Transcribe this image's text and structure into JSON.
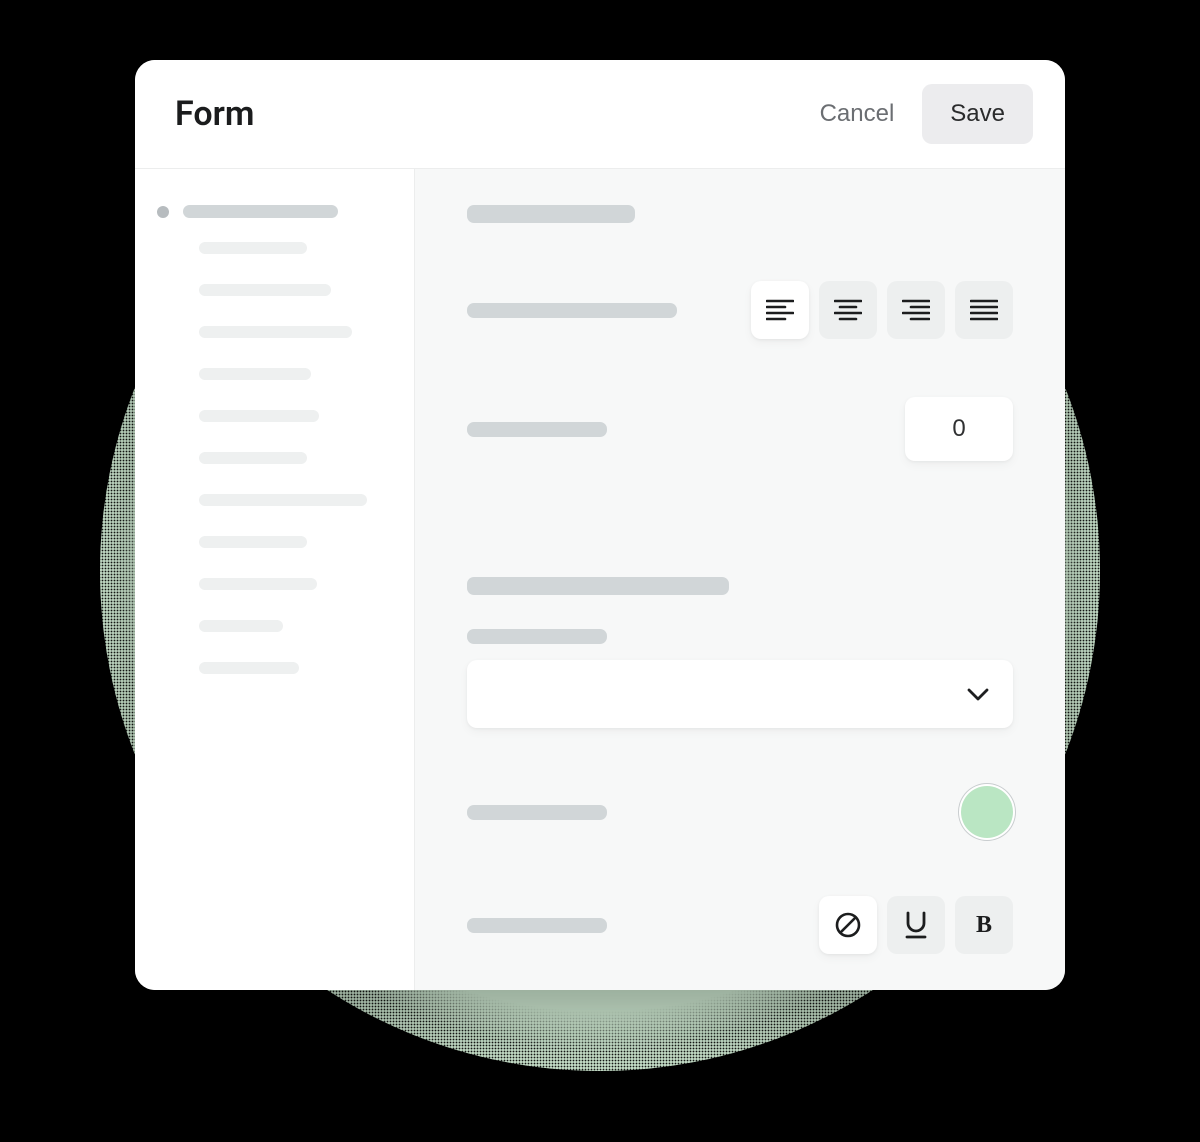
{
  "header": {
    "title": "Form",
    "cancel_label": "Cancel",
    "save_label": "Save"
  },
  "colors": {
    "accent": "#bae6c3"
  },
  "form": {
    "number_value": "0"
  },
  "icons": {
    "align_left": "align-left",
    "align_center": "align-center",
    "align_right": "align-right",
    "align_justify": "align-justify",
    "none": "none",
    "underline": "underline",
    "bold": "bold",
    "chevron_down": "chevron-down"
  }
}
